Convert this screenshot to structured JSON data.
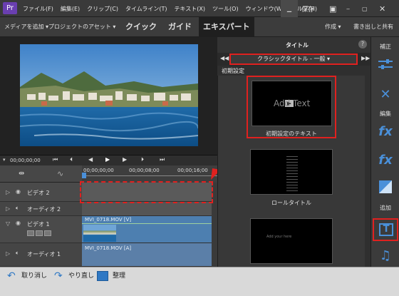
{
  "menubar": {
    "logo": "Pr",
    "items": [
      "ファイル(F)",
      "編集(E)",
      "クリップ(C)",
      "タイムライン(T)",
      "テキスト(X)",
      "ツール(O)",
      "ウィンドウ(W)",
      "ヘルプ(H)"
    ],
    "save_label": "保存"
  },
  "toolbar": {
    "add_media": "メディアを追加",
    "project_assets": "プロジェクトのアセット",
    "modes": [
      "クイック",
      "ガイド",
      "エキスパート"
    ],
    "create": "作成",
    "share": "書き出しと共有"
  },
  "transport": {
    "timecode": "00;00;00;00"
  },
  "ruler": {
    "ticks": [
      "00;00;00;00",
      "00;00;08;00",
      "00;00;16;00"
    ]
  },
  "tracks": [
    {
      "name": "ビデオ 2"
    },
    {
      "name": "オーディオ 2"
    },
    {
      "name": "ビデオ 1",
      "clip": "MVI_0718.MOV [V]"
    },
    {
      "name": "オーディオ 1",
      "clip": "MVI_0718.MOV [A]"
    }
  ],
  "panel": {
    "title": "タイトル",
    "category": "クラシックタイトル - 一般",
    "section": "初期設定",
    "thumbs": [
      {
        "caption": "初期設定のテキスト",
        "sample": "Add Text"
      },
      {
        "caption": "ロールタイトル",
        "sample": ""
      },
      {
        "caption": "",
        "sample": "Add your here"
      }
    ]
  },
  "sidebar": {
    "correct": "補正",
    "edit": "編集",
    "add": "追加"
  },
  "bottombar": {
    "undo": "取り消し",
    "redo": "やり直し",
    "organize": "整理"
  },
  "colors": {
    "highlight": "#e0211f",
    "accent": "#4a90d9",
    "clip_video": "#4d7fb0",
    "clip_audio": "#5b7fa8"
  }
}
